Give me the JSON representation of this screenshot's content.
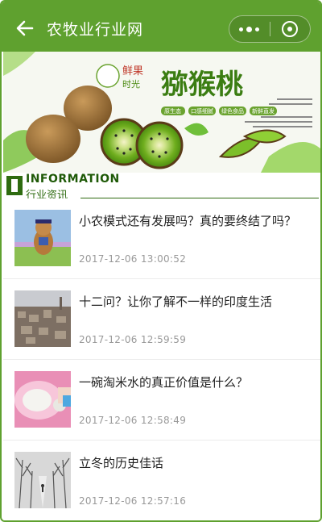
{
  "nav": {
    "title": "农牧业行业网"
  },
  "banner": {
    "brand_text": "猕猴桃",
    "badge_text": "鲜果",
    "badge_sub": "时光",
    "tags": [
      "原生态",
      "口感细腻",
      "绿色食品",
      "新鲜直发"
    ]
  },
  "section": {
    "en": "INFORMATION",
    "zh": "行业资讯"
  },
  "news": [
    {
      "title": "小农模式还有发展吗？真的要终结了吗？",
      "time": "2017-12-06 13:00:52"
    },
    {
      "title": "十二问？让你了解不一样的印度生活",
      "time": "2017-12-06 12:59:59"
    },
    {
      "title": "一碗淘米水的真正价值是什么？",
      "time": "2017-12-06 12:58:49"
    },
    {
      "title": "立冬的历史佳话",
      "time": "2017-12-06 12:57:16"
    }
  ],
  "colors": {
    "nav_green": "#5fa12f",
    "section_green": "#2e6b10",
    "title_text": "#222222",
    "time_text": "#999999"
  },
  "icons": [
    "back-arrow-icon",
    "more-dots-icon",
    "close-target-icon"
  ]
}
